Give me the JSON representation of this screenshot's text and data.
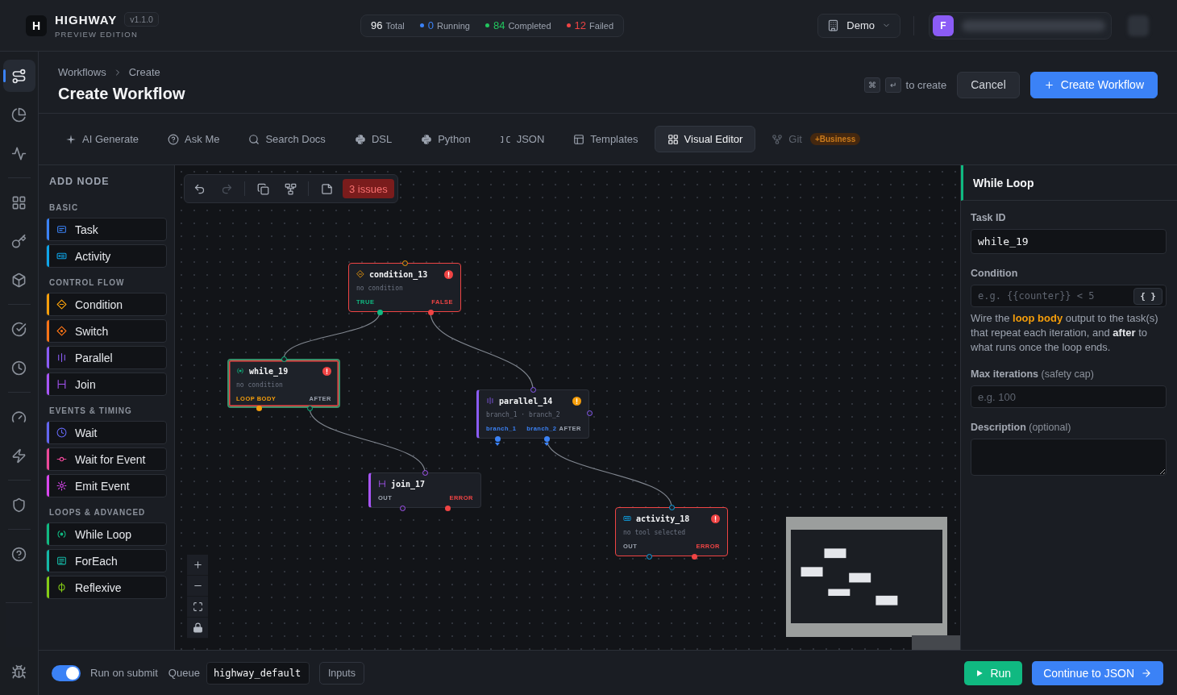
{
  "header": {
    "brand": {
      "logo": "H",
      "name": "HIGHWAY",
      "version": "v1.1.0",
      "edition": "PREVIEW EDITION"
    },
    "stats": [
      {
        "value": "96",
        "label": "Total"
      },
      {
        "value": "0",
        "label": "Running",
        "color": "#3b82f6"
      },
      {
        "value": "84",
        "label": "Completed",
        "color": "#22c55e"
      },
      {
        "value": "12",
        "label": "Failed",
        "color": "#ef4444"
      }
    ],
    "workspace": {
      "label": "Demo"
    },
    "user": {
      "avatar": "F"
    }
  },
  "sidebar": {
    "groups": [
      [
        {
          "selected": true
        },
        {
          "selected": false
        },
        {
          "selected": false
        }
      ],
      [
        {
          "selected": false
        },
        {
          "selected": false
        },
        {
          "selected": false
        }
      ],
      [
        {
          "selected": false
        },
        {
          "selected": false
        }
      ],
      [
        {
          "selected": false
        },
        {
          "selected": false
        }
      ],
      [
        {
          "selected": false
        }
      ],
      [
        {
          "selected": false
        }
      ],
      [
        {
          "selected": false
        }
      ]
    ]
  },
  "page_header": {
    "breadcrumb": [
      "Workflows",
      "Create"
    ],
    "title": "Create Workflow",
    "shortcut": {
      "keys": [
        "⌘",
        "↵"
      ],
      "hint": "to create"
    },
    "cancel_button": "Cancel",
    "create_button": "Create Workflow"
  },
  "tabs": [
    {
      "label": "AI Generate",
      "selected": false,
      "disabled": false
    },
    {
      "label": "Ask Me",
      "selected": false,
      "disabled": false
    },
    {
      "label": "Search Docs",
      "selected": false,
      "disabled": false
    },
    {
      "label": "DSL",
      "selected": false,
      "disabled": false
    },
    {
      "label": "Python",
      "selected": false,
      "disabled": false
    },
    {
      "label": "JSON",
      "selected": false,
      "disabled": false
    },
    {
      "label": "Templates",
      "selected": false,
      "disabled": false
    },
    {
      "label": "Visual Editor",
      "selected": true,
      "disabled": false
    },
    {
      "label": "Git",
      "selected": false,
      "disabled": true,
      "badge": "+Business"
    }
  ],
  "add_node": {
    "title": "ADD NODE",
    "groups": [
      {
        "title": "BASIC",
        "items": [
          {
            "kind": "task",
            "label": "Task",
            "color": "#3b82f6"
          },
          {
            "kind": "activity",
            "label": "Activity",
            "color": "#0ea5e9"
          }
        ]
      },
      {
        "title": "CONTROL FLOW",
        "items": [
          {
            "kind": "condition",
            "label": "Condition",
            "color": "#f59e0b"
          },
          {
            "kind": "switch",
            "label": "Switch",
            "color": "#f97316"
          },
          {
            "kind": "parallel",
            "label": "Parallel",
            "color": "#8b5cf6"
          },
          {
            "kind": "join",
            "label": "Join",
            "color": "#a855f7"
          }
        ]
      },
      {
        "title": "EVENTS & TIMING",
        "items": [
          {
            "kind": "wait",
            "label": "Wait",
            "color": "#6366f1"
          },
          {
            "kind": "wait_event",
            "label": "Wait for Event",
            "color": "#ec4899"
          },
          {
            "kind": "emit_event",
            "label": "Emit Event",
            "color": "#d946ef"
          }
        ]
      },
      {
        "title": "LOOPS & ADVANCED",
        "items": [
          {
            "kind": "while",
            "label": "While Loop",
            "color": "#10b981"
          },
          {
            "kind": "foreach",
            "label": "ForEach",
            "color": "#14b8a6"
          },
          {
            "kind": "reflexive",
            "label": "Reflexive",
            "color": "#84cc16"
          }
        ]
      }
    ]
  },
  "canvas": {
    "toolbar": {
      "tools": [
        {
          "disabled": false
        },
        {
          "disabled": true
        },
        {
          "disabled": false
        },
        {
          "disabled": false
        },
        {
          "disabled": false
        }
      ],
      "issues": "3 issues"
    },
    "nodes": [
      {
        "kind": "condition",
        "id": "condition_13",
        "detail": "no condition",
        "error": true,
        "warning": false,
        "selected": false,
        "outputs": [
          {
            "label": "TRUE",
            "color": "#10b981",
            "filled": true
          },
          {
            "label": "FALSE",
            "color": "#ef4444",
            "filled": true
          }
        ]
      },
      {
        "kind": "while",
        "id": "while_19",
        "detail": "no condition",
        "error": true,
        "warning": false,
        "selected": true,
        "outputs": [
          {
            "label": "LOOP BODY",
            "color": "#f59e0b",
            "filled": true
          },
          {
            "label": "AFTER",
            "color": "#9ca3af",
            "filled": false
          }
        ]
      },
      {
        "kind": "parallel",
        "id": "parallel_14",
        "detail": "branch_1 · branch_2",
        "error": false,
        "warning": true,
        "selected": false,
        "outputs": [
          {
            "label": "branch_1",
            "color": "#3b82f6",
            "filled": true
          },
          {
            "label": "branch_2",
            "color": "#3b82f6",
            "filled": true
          },
          {
            "label": "AFTER",
            "color": "#9ca3af",
            "filled": false
          }
        ]
      },
      {
        "kind": "join",
        "id": "join_17",
        "error": false,
        "warning": false,
        "selected": false,
        "outputs": [
          {
            "label": "OUT",
            "color": "#9ca3af",
            "filled": false
          },
          {
            "label": "ERROR",
            "color": "#ef4444",
            "filled": true
          }
        ]
      },
      {
        "kind": "activity",
        "id": "activity_18",
        "detail": "no tool selected",
        "error": true,
        "warning": false,
        "selected": false,
        "outputs": [
          {
            "label": "OUT",
            "color": "#9ca3af",
            "filled": false
          },
          {
            "label": "ERROR",
            "color": "#ef4444",
            "filled": true
          }
        ]
      }
    ]
  },
  "inspector": {
    "title": "While Loop",
    "fields": [
      {
        "kind": "code",
        "label": "Task ID",
        "value": "while_19"
      },
      {
        "kind": "code",
        "label": "Condition",
        "placeholder": "e.g. {{counter}} < 5",
        "button": "{ }",
        "help": "Wire the **loop body** output to the task(s) that repeat each iteration, and **after** to what runs once the loop ends."
      },
      {
        "kind": "text",
        "label": "Max iterations",
        "note": "(safety cap)",
        "placeholder": "e.g. 100"
      },
      {
        "kind": "textarea",
        "label": "Description",
        "note": "(optional)"
      }
    ]
  },
  "bottom_bar": {
    "run_on_submit": {
      "label": "Run on submit",
      "on": true
    },
    "queue": {
      "label": "Queue",
      "value": "highway_default"
    },
    "inputs_button": "Inputs",
    "run_button": "Run",
    "continue_button": "Continue to JSON"
  }
}
